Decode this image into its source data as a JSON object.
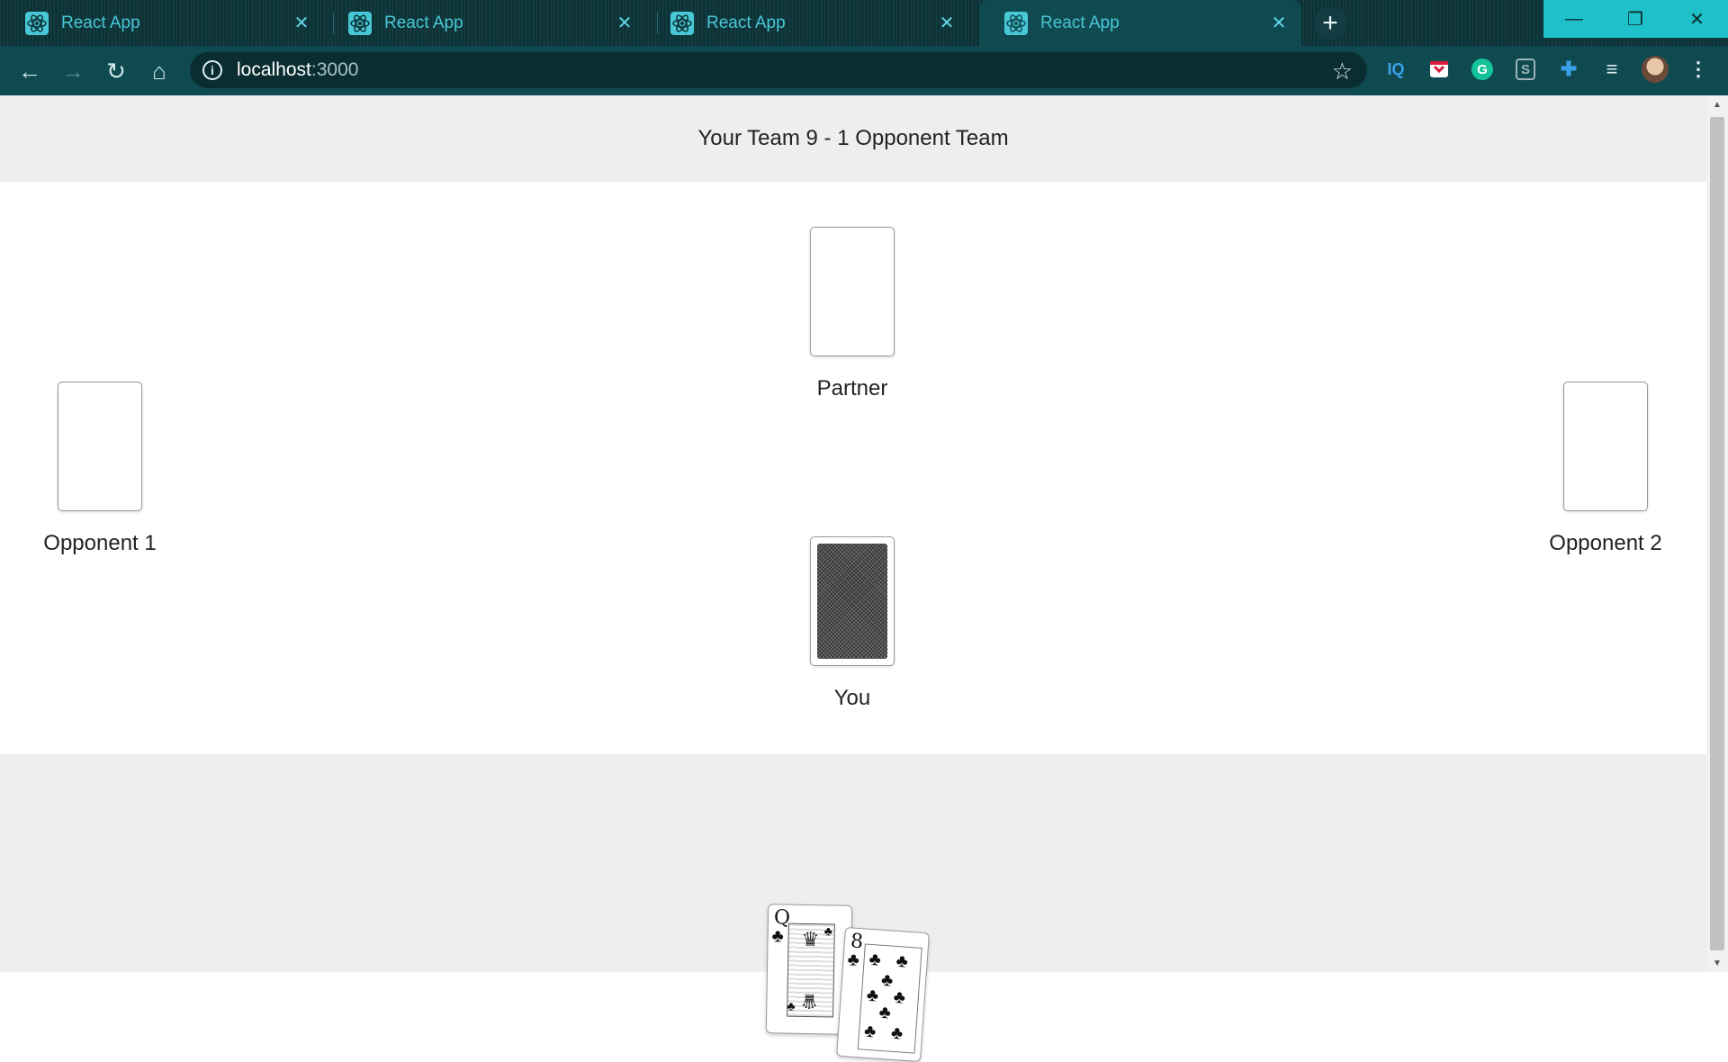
{
  "browser": {
    "tabs": [
      {
        "title": "React App",
        "active": false
      },
      {
        "title": "React App",
        "active": false
      },
      {
        "title": "React App",
        "active": false
      },
      {
        "title": "React App",
        "active": true
      }
    ],
    "url_host": "localhost",
    "url_port": ":3000",
    "extensions": [
      "iq-icon",
      "pocket-icon",
      "grammarly-icon",
      "s-extension-icon",
      "puzzle-icon",
      "media-queue-icon",
      "profile-avatar",
      "more-menu-icon"
    ],
    "ext_labels": {
      "iq": "IQ",
      "grammarly": "G",
      "s": "S"
    }
  },
  "game": {
    "score_text": "Your Team 9 - 1 Opponent Team",
    "players": {
      "partner": "Partner",
      "opponent1": "Opponent 1",
      "opponent2": "Opponent 2",
      "you": "You"
    },
    "hand": [
      {
        "rank": "Q",
        "suit": "♣"
      },
      {
        "rank": "8",
        "suit": "♣"
      }
    ]
  },
  "colors": {
    "tab_text": "#48c7d6",
    "toolbar": "#0f4a50",
    "panel_gray": "#eeeeee"
  }
}
